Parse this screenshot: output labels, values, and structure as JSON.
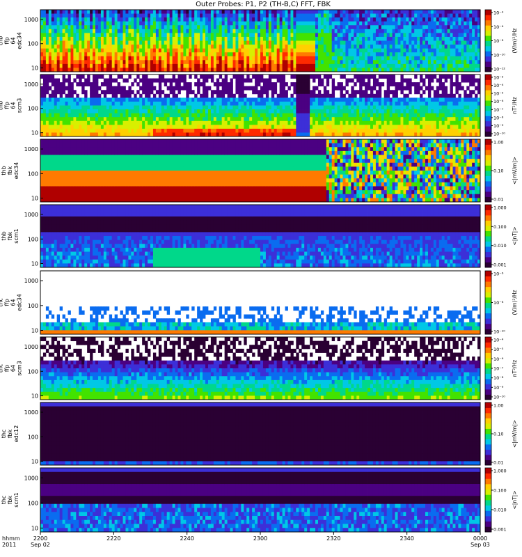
{
  "chart_data": {
    "type": "heatmap",
    "title": "Outer Probes: P1, P2 (TH-B,C) FFT, FBK",
    "x_axis": {
      "row_labels": [
        "hhmm",
        "2011"
      ],
      "ticks": [
        {
          "top": "2200",
          "bottom": "Sep 02"
        },
        {
          "top": "2220",
          "bottom": ""
        },
        {
          "top": "2240",
          "bottom": ""
        },
        {
          "top": "2300",
          "bottom": ""
        },
        {
          "top": "2320",
          "bottom": ""
        },
        {
          "top": "2340",
          "bottom": ""
        },
        {
          "top": "0000",
          "bottom": "Sep 03"
        }
      ]
    },
    "y_ticks": [
      "10",
      "100",
      "1000"
    ],
    "panels": [
      {
        "ylabel": [
          "thb",
          "ffp",
          "64",
          "edc34"
        ],
        "colorbar_label": "(V/m)²/Hz",
        "colorbar_ticks": [
          "10⁻¹²",
          "10⁻¹⁰",
          "10⁻⁸",
          "10⁻⁶",
          "10⁻⁴"
        ],
        "scale": "log"
      },
      {
        "ylabel": [
          "thb",
          "ffp",
          "64",
          "scm3"
        ],
        "colorbar_label": "nT²/Hz",
        "colorbar_ticks": [
          "10⁻¹⁰",
          "10⁻⁹",
          "10⁻⁸",
          "10⁻⁷",
          "10⁻⁶",
          "10⁻⁵",
          "10⁻⁴",
          "10⁻³"
        ],
        "scale": "log"
      },
      {
        "ylabel": [
          "thb",
          "fbk",
          "edc34"
        ],
        "colorbar_label": "<|mV/m|>",
        "colorbar_ticks": [
          "0.01",
          "0.10",
          "1.00"
        ],
        "scale": "log"
      },
      {
        "ylabel": [
          "thb",
          "fbk",
          "scm1"
        ],
        "colorbar_label": "<|nT|>",
        "colorbar_ticks": [
          "0.001",
          "0.010",
          "0.100",
          "1.000"
        ],
        "scale": "log"
      },
      {
        "ylabel": [
          "thc",
          "ffp",
          "64",
          "edc34"
        ],
        "colorbar_label": "(V/m)²/Hz",
        "colorbar_ticks": [
          "10⁻¹⁰",
          "10⁻⁸",
          "10⁻⁶"
        ],
        "scale": "log"
      },
      {
        "ylabel": [
          "thc",
          "ffp",
          "64",
          "scm3"
        ],
        "colorbar_label": "nT²/Hz",
        "colorbar_ticks": [
          "10⁻¹⁰",
          "10⁻⁹",
          "10⁻⁸",
          "10⁻⁷",
          "10⁻⁶",
          "10⁻⁵",
          "10⁻⁴"
        ],
        "scale": "log"
      },
      {
        "ylabel": [
          "thc",
          "fbk",
          "edc12"
        ],
        "colorbar_label": "<|mV/m|>",
        "colorbar_ticks": [
          "0.01",
          "0.10",
          "1.00"
        ],
        "scale": "log"
      },
      {
        "ylabel": [
          "thc",
          "fbk",
          "scm1"
        ],
        "colorbar_label": "<|nT|>",
        "colorbar_ticks": [
          "0.001",
          "0.010",
          "0.100",
          "1.000"
        ],
        "scale": "log"
      }
    ]
  },
  "colors": {
    "spectrum": [
      "#2a0033",
      "#4b0082",
      "#3c2fd8",
      "#0a6cf0",
      "#00c8e6",
      "#00d88a",
      "#42e300",
      "#d8ef00",
      "#ffd000",
      "#ff7a00",
      "#ff2a00",
      "#b00000"
    ]
  }
}
